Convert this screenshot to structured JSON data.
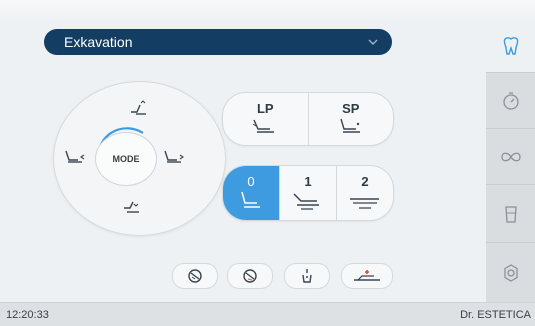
{
  "program": {
    "label": "Exkavation",
    "chevron_icon": "chevron-down-icon"
  },
  "pad": {
    "mode_label": "MODE",
    "accent": "#3e9be0"
  },
  "lp_sp": {
    "lp_label": "LP",
    "sp_label": "SP"
  },
  "memory": {
    "positions": [
      "0",
      "1",
      "2"
    ],
    "active": "0"
  },
  "sidebar": {
    "items": [
      {
        "icon": "tooth-icon",
        "active": true
      },
      {
        "icon": "timer-icon",
        "active": false
      },
      {
        "icon": "infinity-icon",
        "active": false
      },
      {
        "icon": "cup-icon",
        "active": false
      },
      {
        "icon": "settings-icon",
        "active": false
      }
    ]
  },
  "status": {
    "time": "12:20:33",
    "brand": "Dr. ESTETICA"
  },
  "colors": {
    "brand_dark": "#143d63",
    "accent": "#3e9be0",
    "background": "#eef1f3"
  }
}
